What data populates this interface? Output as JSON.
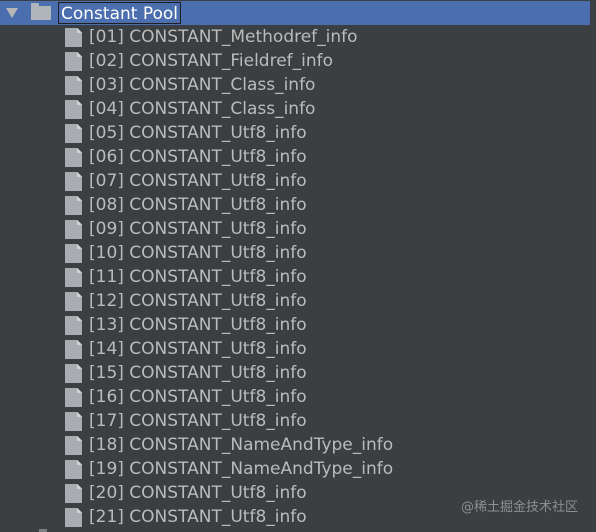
{
  "tree": {
    "root": {
      "label": "Constant Pool",
      "expanded": true,
      "selected": true,
      "icon": "folder-icon"
    },
    "items": [
      {
        "label": "[01] CONSTANT_Methodref_info",
        "icon": "file-icon"
      },
      {
        "label": "[02] CONSTANT_Fieldref_info",
        "icon": "file-icon"
      },
      {
        "label": "[03] CONSTANT_Class_info",
        "icon": "file-icon"
      },
      {
        "label": "[04] CONSTANT_Class_info",
        "icon": "file-icon"
      },
      {
        "label": "[05] CONSTANT_Utf8_info",
        "icon": "file-icon"
      },
      {
        "label": "[06] CONSTANT_Utf8_info",
        "icon": "file-icon"
      },
      {
        "label": "[07] CONSTANT_Utf8_info",
        "icon": "file-icon"
      },
      {
        "label": "[08] CONSTANT_Utf8_info",
        "icon": "file-icon"
      },
      {
        "label": "[09] CONSTANT_Utf8_info",
        "icon": "file-icon"
      },
      {
        "label": "[10] CONSTANT_Utf8_info",
        "icon": "file-icon"
      },
      {
        "label": "[11] CONSTANT_Utf8_info",
        "icon": "file-icon"
      },
      {
        "label": "[12] CONSTANT_Utf8_info",
        "icon": "file-icon"
      },
      {
        "label": "[13] CONSTANT_Utf8_info",
        "icon": "file-icon"
      },
      {
        "label": "[14] CONSTANT_Utf8_info",
        "icon": "file-icon"
      },
      {
        "label": "[15] CONSTANT_Utf8_info",
        "icon": "file-icon"
      },
      {
        "label": "[16] CONSTANT_Utf8_info",
        "icon": "file-icon"
      },
      {
        "label": "[17] CONSTANT_Utf8_info",
        "icon": "file-icon"
      },
      {
        "label": "[18] CONSTANT_NameAndType_info",
        "icon": "file-icon"
      },
      {
        "label": "[19] CONSTANT_NameAndType_info",
        "icon": "file-icon"
      },
      {
        "label": "[20] CONSTANT_Utf8_info",
        "icon": "file-icon"
      },
      {
        "label": "[21] CONSTANT_Utf8_info",
        "icon": "file-icon"
      }
    ]
  },
  "watermark": {
    "text": "@稀土掘金技术社区"
  },
  "colors": {
    "background": "#3c3f41",
    "selection": "#4b6eaf",
    "text": "#bbbbbb",
    "selected_text": "#ffffff",
    "icon": "#b0b5ba"
  }
}
